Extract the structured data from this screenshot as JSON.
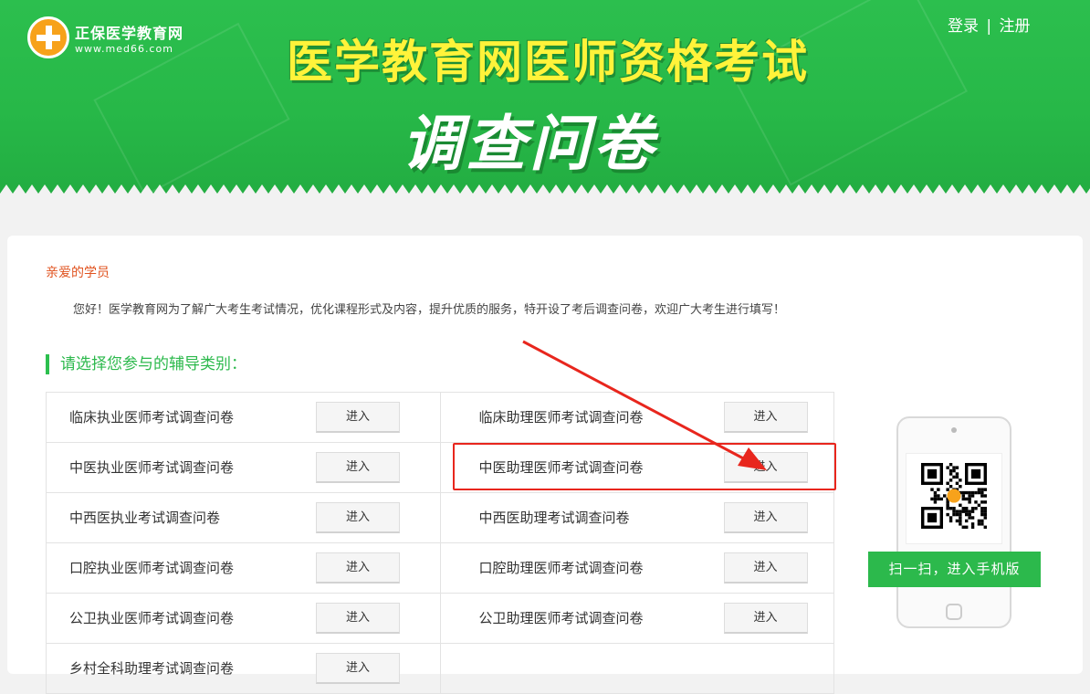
{
  "header": {
    "logo_name": "正保医学教育网",
    "logo_url": "www.med66.com",
    "login": "登录",
    "separator": "|",
    "register": "注册",
    "title": "医学教育网医师资格考试",
    "subtitle": "调查问卷"
  },
  "greeting": "亲爱的学员",
  "intro": "您好！医学教育网为了解广大考生考试情况，优化课程形式及内容，提升优质的服务，特开设了考后调查问卷，欢迎广大考生进行填写！",
  "section_title": "请选择您参与的辅导类别：",
  "enter_label": "进入",
  "surveys": [
    {
      "left": "临床执业医师考试调查问卷",
      "right": "临床助理医师考试调查问卷"
    },
    {
      "left": "中医执业医师考试调查问卷",
      "right": "中医助理医师考试调查问卷"
    },
    {
      "left": "中西医执业考试调查问卷",
      "right": "中西医助理考试调查问卷"
    },
    {
      "left": "口腔执业医师考试调查问卷",
      "right": "口腔助理医师考试调查问卷"
    },
    {
      "left": "公卫执业医师考试调查问卷",
      "right": "公卫助理医师考试调查问卷"
    },
    {
      "left": "乡村全科助理考试调查问卷",
      "right": ""
    }
  ],
  "mobile": {
    "scan_label": "扫一扫，进入手机版"
  },
  "colors": {
    "brand_green": "#2cbf4e",
    "title_yellow": "#fff33a",
    "highlight_red": "#e8261d",
    "greeting_orange": "#e0521e"
  }
}
